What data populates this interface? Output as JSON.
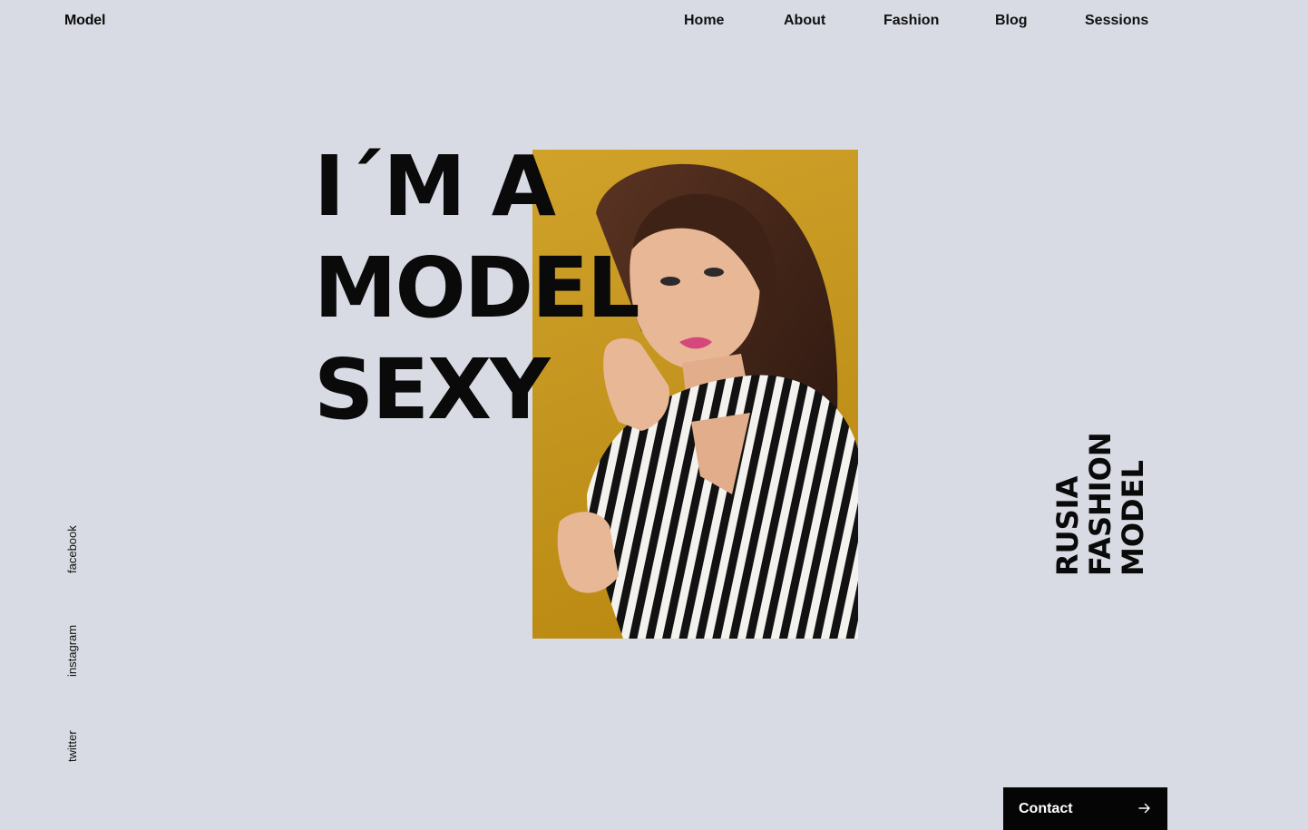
{
  "header": {
    "logo": "Model",
    "nav": [
      "Home",
      "About",
      "Fashion",
      "Blog",
      "Sessions"
    ]
  },
  "hero": {
    "lines": [
      "I´M A",
      "MODEL",
      "SEXY"
    ],
    "photo_background": "#c89a22"
  },
  "side_title": [
    "RUSIA",
    "FASHION",
    "MODEL"
  ],
  "social": [
    "facebook",
    "instagram",
    "twitter"
  ],
  "contact": {
    "label": "Contact",
    "icon": "arrow-right-icon"
  },
  "colors": {
    "page_background": "#d8dbe3",
    "text": "#0a0a0a",
    "button_background": "#050505",
    "button_text": "#ffffff"
  }
}
